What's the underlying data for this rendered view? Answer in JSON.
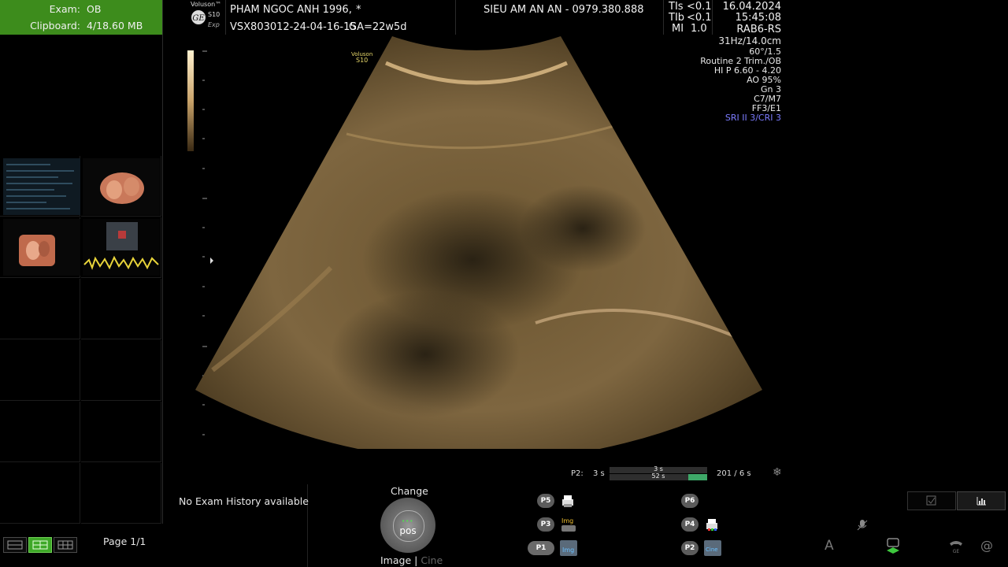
{
  "exam_panel": {
    "exam_label": "Exam:",
    "exam_value": "OB",
    "clipboard_label": "Clipboard:",
    "clipboard_value": "4/18.60 MB",
    "page_indicator": "Page 1/1"
  },
  "header": {
    "brand": "Voluson™",
    "model": "S10",
    "model_sub": "Exp",
    "patient_name": "PHAM NGOC ANH 1996,",
    "patient_flag": "*",
    "patient_id": "VSX803012-24-04-16-15",
    "gestational_age": "GA=22w5d",
    "clinic": "SIEU AM AN AN - 0979.380.888",
    "tis_label": "TIs",
    "tis_value": "<0.1",
    "tib_label": "TIb",
    "tib_value": "<0.1",
    "mi_label": "MI",
    "mi_value": "1.0",
    "date": "16.04.2024",
    "time": "15:45:08",
    "probe": "RAB6-RS"
  },
  "imaging_params": {
    "frame_depth": "31Hz/14.0cm",
    "angle": "60°/1.5",
    "preset": "Routine 2 Trim./OB",
    "harmonic": "HI P 6.60 - 4.20",
    "ao": "AO 95%",
    "gain": "Gn   3",
    "c_m": "C7/M7",
    "ff_e": "FF3/E1",
    "sri_cri": "SRI II 3/CRI 3",
    "sri_color": "#7c7cff"
  },
  "image_area": {
    "watermark_brand": "Voluson",
    "watermark_model": "S10"
  },
  "cine": {
    "label": "P2:",
    "left_time": "3 s",
    "bar_top": "3 s",
    "bar_bottom": "52 s",
    "frames": "201 / 6 s"
  },
  "footer": {
    "exam_history": "No Exam History available",
    "change_label": "Change",
    "pos_label": "pos",
    "image_label": "Image",
    "separator": "|",
    "cine_label": "Cine",
    "p1": "P1",
    "p2": "P2",
    "p3": "P3",
    "p4": "P4",
    "p5": "P5",
    "p6": "P6",
    "img_tag": "Img",
    "cine_tag": "Cine",
    "text_tool": "A",
    "ge_tag": "GE",
    "at_symbol": "@"
  },
  "colors": {
    "exam_header_bg": "#3d8c1c",
    "active_green": "#3ea828"
  }
}
